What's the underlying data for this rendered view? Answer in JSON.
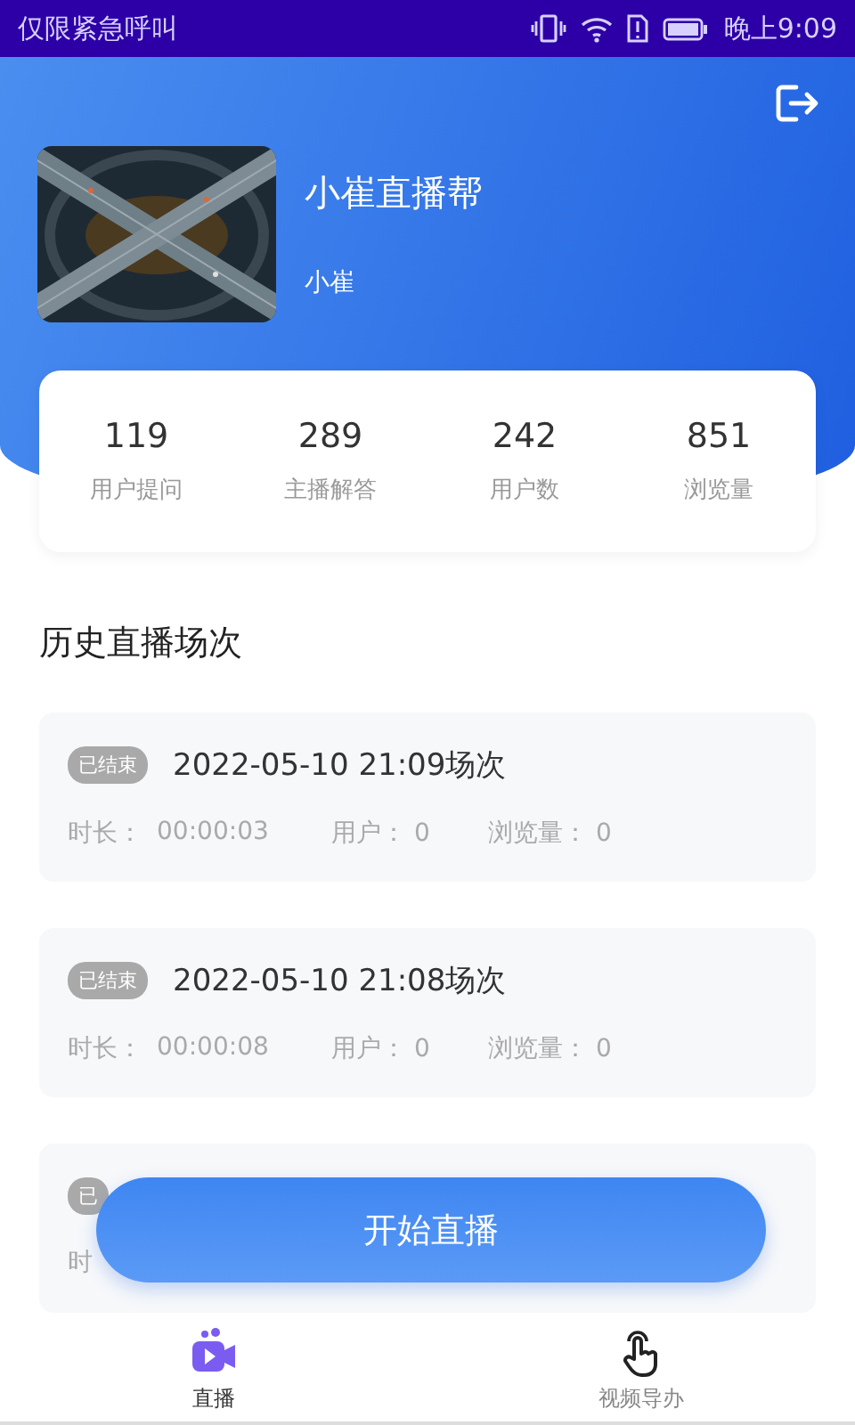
{
  "status_bar": {
    "carrier": "仅限紧急呼叫",
    "time": "晚上9:09"
  },
  "profile": {
    "title": "小崔直播帮",
    "name": "小崔"
  },
  "stats": [
    {
      "value": "119",
      "label": "用户提问"
    },
    {
      "value": "289",
      "label": "主播解答"
    },
    {
      "value": "242",
      "label": "用户数"
    },
    {
      "value": "851",
      "label": "浏览量"
    }
  ],
  "section_title": "历史直播场次",
  "sessions": [
    {
      "kind": "full",
      "badge": "已结束",
      "title": "2022-05-10 21:09场次",
      "duration_label": "时长：",
      "duration": "00:00:03",
      "users": "用户：  0",
      "views": "浏览量：  0"
    },
    {
      "kind": "full",
      "badge": "已结束",
      "title": "2022-05-10 21:08场次",
      "duration_label": "时长：",
      "duration": "00:00:08",
      "users": "用户：  0",
      "views": "浏览量：  0"
    },
    {
      "kind": "partial",
      "badge": "已",
      "duration_label": "时"
    }
  ],
  "start_button": "开始直播",
  "nav": [
    {
      "label": "直播",
      "selected": true
    },
    {
      "label": "视频导办",
      "selected": false
    }
  ]
}
